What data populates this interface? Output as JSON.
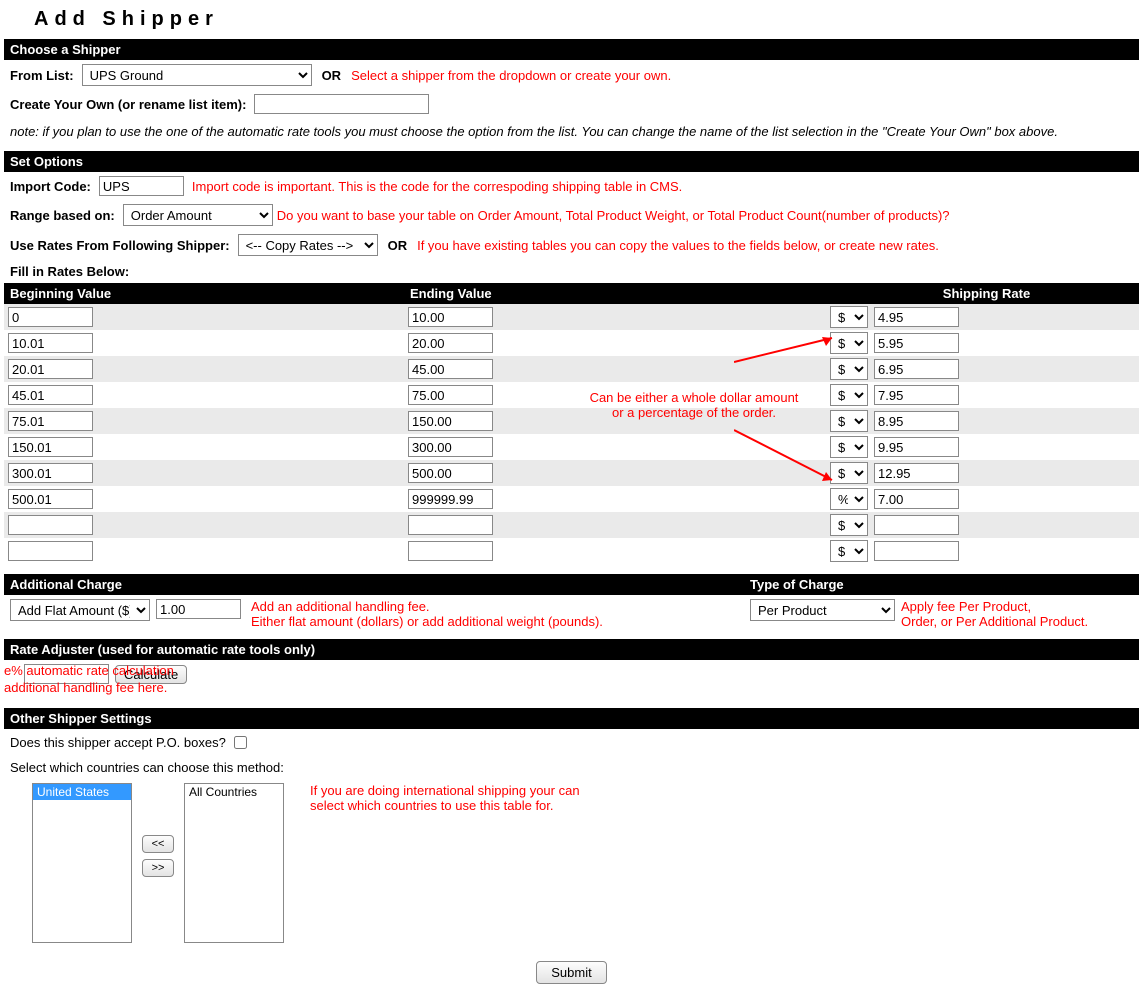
{
  "title": "Add Shipper",
  "section_choose": "Choose a Shipper",
  "from_list_label": "From List:",
  "from_list_value": "UPS Ground",
  "or": "OR",
  "annot_shipper": "Select a shipper from the dropdown or create your own.",
  "create_own_label": "Create Your Own (or rename list item):",
  "create_own_value": "",
  "note_auto": "note: if you plan to use the one of the automatic rate tools you must choose the option from the list. You can change the name of the list selection in the \"Create Your Own\" box above.",
  "section_options": "Set Options",
  "import_code_label": "Import Code:",
  "import_code_value": "UPS",
  "annot_import": "Import code is important. This is the code for the correspoding shipping table in CMS.",
  "range_label": "Range based on:",
  "range_value": "Order Amount",
  "annot_range": "Do you want to base your table on Order Amount, Total Product Weight, or Total Product Count(number of products)?",
  "use_rates_label": "Use Rates From Following Shipper:",
  "use_rates_value": "<-- Copy Rates -->",
  "annot_use_rates": "If you have existing tables you can copy the values to the fields below, or create new rates.",
  "fill_rates_label": "Fill in Rates Below:",
  "rates_head": {
    "begin": "Beginning Value",
    "end": "Ending Value",
    "rate": "Shipping Rate"
  },
  "rates_annot_l1": "Can be either a whole dollar amount",
  "rates_annot_l2": "or a percentage of the order.",
  "rates": [
    {
      "begin": "0",
      "end": "10.00",
      "unit": "$",
      "rate": "4.95"
    },
    {
      "begin": "10.01",
      "end": "20.00",
      "unit": "$",
      "rate": "5.95"
    },
    {
      "begin": "20.01",
      "end": "45.00",
      "unit": "$",
      "rate": "6.95"
    },
    {
      "begin": "45.01",
      "end": "75.00",
      "unit": "$",
      "rate": "7.95"
    },
    {
      "begin": "75.01",
      "end": "150.00",
      "unit": "$",
      "rate": "8.95"
    },
    {
      "begin": "150.01",
      "end": "300.00",
      "unit": "$",
      "rate": "9.95"
    },
    {
      "begin": "300.01",
      "end": "500.00",
      "unit": "$",
      "rate": "12.95"
    },
    {
      "begin": "500.01",
      "end": "999999.99",
      "unit": "%",
      "rate": "7.00"
    },
    {
      "begin": "",
      "end": "",
      "unit": "$",
      "rate": ""
    },
    {
      "begin": "",
      "end": "",
      "unit": "$",
      "rate": ""
    }
  ],
  "addl_charge_head": "Additional Charge",
  "type_charge_head": "Type of Charge",
  "addl_type_value": "Add Flat Amount ($)",
  "addl_amount_value": "1.00",
  "type_charge_value": "Per Product",
  "annot_addl_l1": "Add an additional handling fee.",
  "annot_addl_l2": "Either flat amount (dollars) or add additional weight (pounds).",
  "annot_type_l1": "Apply fee Per Product,",
  "annot_type_l2": "Order, or Per Additional Product.",
  "section_adjuster": "Rate Adjuster (used for automatic rate tools only)",
  "adjuster_pct_value": "",
  "adjuster_btn": "Calculate",
  "adjuster_overlay_l1": "e% automatic rate calculation",
  "adjuster_overlay_l2": "additional handling fee here.",
  "section_other": "Other Shipper Settings",
  "pobox_label": "Does this shipper accept P.O. boxes?",
  "countries_label": "Select which countries can choose this method:",
  "country_selected": "United States",
  "country_all": "All Countries",
  "move_left": "<<",
  "move_right": ">>",
  "annot_countries_l1": "If you are doing international shipping your can",
  "annot_countries_l2": "select which countries to use this table for.",
  "submit": "Submit"
}
